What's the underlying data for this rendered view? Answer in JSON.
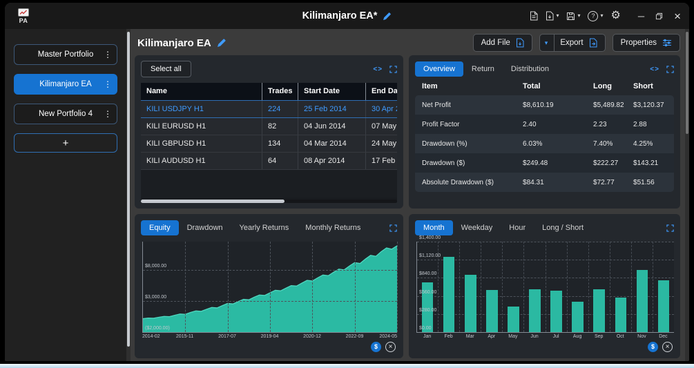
{
  "window": {
    "title": "Kilimanjaro EA*"
  },
  "titlebar": {
    "logo_text": "PA"
  },
  "glyphs": {
    "kebab": "⋮",
    "caret_down": "▾",
    "code": "<>",
    "help": "?",
    "gear": "⚙",
    "minimize": "─",
    "close": "×",
    "dollar": "$",
    "chart_close": "×"
  },
  "sidebar": {
    "items": [
      {
        "label": "Master Portfolio",
        "active": false
      },
      {
        "label": "Kilimanjaro EA",
        "active": true
      },
      {
        "label": "New Portfolio 4",
        "active": false
      }
    ],
    "add_button": "+"
  },
  "main_header": {
    "title": "Kilimanjaro EA",
    "add_file_label": "Add File",
    "export_label": "Export",
    "properties_label": "Properties"
  },
  "trades_panel": {
    "select_all_label": "Select all",
    "columns": [
      "Name",
      "Trades",
      "Start Date",
      "End Date"
    ],
    "rows": [
      {
        "name": "KILI USDJPY H1",
        "trades": "224",
        "start_date": "25 Feb 2014",
        "end_date": "30 Apr 2",
        "selected": true
      },
      {
        "name": "KILI EURUSD H1",
        "trades": "82",
        "start_date": "04 Jun 2014",
        "end_date": "07 May 2",
        "selected": false
      },
      {
        "name": "KILI GBPUSD H1",
        "trades": "134",
        "start_date": "04 Mar 2014",
        "end_date": "24 May 2",
        "selected": false
      },
      {
        "name": "KILI AUDUSD H1",
        "trades": "64",
        "start_date": "08 Apr 2014",
        "end_date": "17 Feb 2",
        "selected": false
      }
    ]
  },
  "stats_panel": {
    "tabs": [
      "Overview",
      "Return",
      "Distribution"
    ],
    "active_tab": "Overview",
    "columns": [
      "Item",
      "Total",
      "Long",
      "Short"
    ],
    "rows": [
      [
        "Net Profit",
        "$8,610.19",
        "$5,489.82",
        "$3,120.37"
      ],
      [
        "Profit Factor",
        "2.40",
        "2.23",
        "2.88"
      ],
      [
        "Drawdown (%)",
        "6.03%",
        "7.40%",
        "4.25%"
      ],
      [
        "Drawdown ($)",
        "$249.48",
        "$222.27",
        "$143.21"
      ],
      [
        "Absolute Drawdown ($)",
        "$84.31",
        "$72.77",
        "$51.56"
      ]
    ]
  },
  "equity_panel": {
    "tabs": [
      "Equity",
      "Drawdown",
      "Yearly Returns",
      "Monthly Returns"
    ],
    "active_tab": "Equity"
  },
  "monthly_panel": {
    "tabs": [
      "Month",
      "Weekday",
      "Hour",
      "Long / Short"
    ],
    "active_tab": "Month"
  },
  "chart_data": [
    {
      "type": "area",
      "title": "Equity",
      "x_labels": [
        "2014-02",
        "2015-11",
        "2017-07",
        "2019-04",
        "2020-12",
        "2022-09",
        "2024-05"
      ],
      "ylim": [
        -2000,
        12500
      ],
      "gridlines": [
        {
          "value": 8000,
          "label": "$8,000.00"
        },
        {
          "value": 3000,
          "label": "$3,000.00"
        },
        {
          "value": -2000,
          "label": "($2,000.00)"
        }
      ],
      "values": [
        150,
        250,
        220,
        380,
        520,
        480,
        700,
        900,
        850,
        1150,
        1400,
        1330,
        1650,
        1950,
        1880,
        2250,
        2600,
        2520,
        2900,
        3250,
        3180,
        3600,
        3950,
        3880,
        4300,
        4700,
        4620,
        5050,
        5450,
        5380,
        5850,
        6300,
        6200,
        6700,
        7150,
        7050,
        7600,
        8100,
        7980,
        8600,
        9150,
        9000,
        9700,
        10300,
        10150,
        10900,
        11500,
        11300,
        11850
      ],
      "grid": true,
      "legend": "none"
    },
    {
      "type": "bar",
      "title": "Monthly Returns",
      "categories": [
        "Jan",
        "Feb",
        "Mar",
        "Apr",
        "May",
        "Jun",
        "Jul",
        "Aug",
        "Sep",
        "Oct",
        "Nov",
        "Dec"
      ],
      "values": [
        770,
        1165,
        890,
        650,
        400,
        665,
        645,
        475,
        665,
        535,
        965,
        800
      ],
      "ylim": [
        0,
        1400
      ],
      "y_tick_labels": [
        "$1,400.00",
        "$1,120.00",
        "$840.00",
        "$560.00",
        "$280.00",
        "$0.00"
      ],
      "grid": true,
      "legend": "none"
    }
  ],
  "colors": {
    "accent": "#1673d1",
    "teal": "#2bb9a2",
    "link_blue": "#3f9bff"
  }
}
